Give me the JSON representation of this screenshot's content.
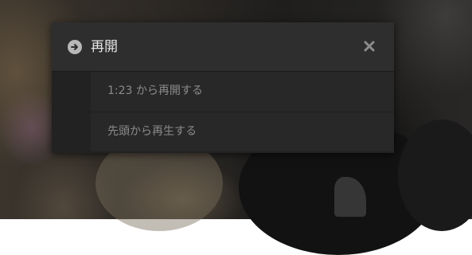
{
  "dialog": {
    "icon": "arrow-right-circle-icon",
    "title": "再開",
    "close_icon": "close-icon"
  },
  "options": [
    {
      "label": "1:23 から再開する"
    },
    {
      "label": "先頭から再生する"
    }
  ],
  "colors": {
    "header_bg": "#2e2e2e",
    "item_bg": "#282828",
    "title_text": "#e6e6e6",
    "item_text": "#8a8a8a"
  }
}
